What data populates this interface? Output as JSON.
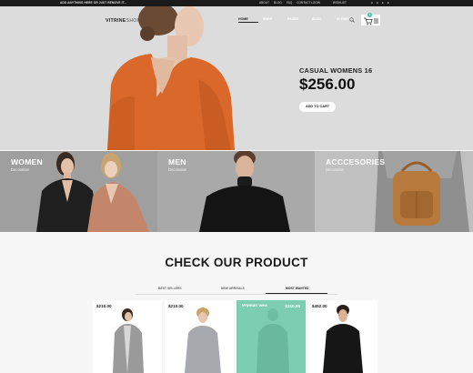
{
  "topbar": {
    "promo": "ADD ANYTHING HERE OR JUST REMOVE IT...",
    "links": [
      "ABOUT",
      "BLOG",
      "FAQ",
      "CONTACT"
    ],
    "account": "LOGIN",
    "wishlist": "WISHLIST",
    "social_icons": [
      "twitter-icon",
      "facebook-icon",
      "instagram-icon",
      "pinterest-icon"
    ]
  },
  "header": {
    "logo": "VITRINE",
    "logo_sub": "SHOP",
    "nav": [
      {
        "label": "HOME",
        "active": true
      },
      {
        "label": "SHOP",
        "active": false
      },
      {
        "label": "PAGES",
        "active": false
      },
      {
        "label": "BLOG",
        "active": false
      },
      {
        "label": "ELEMENTS",
        "active": false
      },
      {
        "label": "BLOG",
        "active": false
      }
    ],
    "cart_count": "3"
  },
  "hero": {
    "subtitle": "CASUAL WOMENS 16",
    "price": "$256.00",
    "button": "ADD TO CART"
  },
  "categories": [
    {
      "title": "WOMEN",
      "desc": "Decoration"
    },
    {
      "title": "MEN",
      "desc": "Decoration"
    },
    {
      "title": "ACCCESORIES",
      "desc": "Decoration"
    }
  ],
  "products_section": {
    "title": "CHECK OUR PRODUCT",
    "tabs": [
      {
        "label": "BEST SELLERS",
        "active": false
      },
      {
        "label": "NEW ARRIVALS",
        "active": false
      },
      {
        "label": "MOST WANTED",
        "active": true
      }
    ]
  },
  "products": [
    {
      "price": "$210.00",
      "highlighted": false,
      "name": ""
    },
    {
      "price": "$210.00",
      "highlighted": false,
      "name": ""
    },
    {
      "price": "$210.00",
      "highlighted": true,
      "name": "Woman wea"
    },
    {
      "price": "$452.00",
      "highlighted": false,
      "name": ""
    }
  ],
  "colors": {
    "accent": "#4bc3a5",
    "highlight": "#7ccdb2",
    "dark": "#1a1a1a"
  }
}
